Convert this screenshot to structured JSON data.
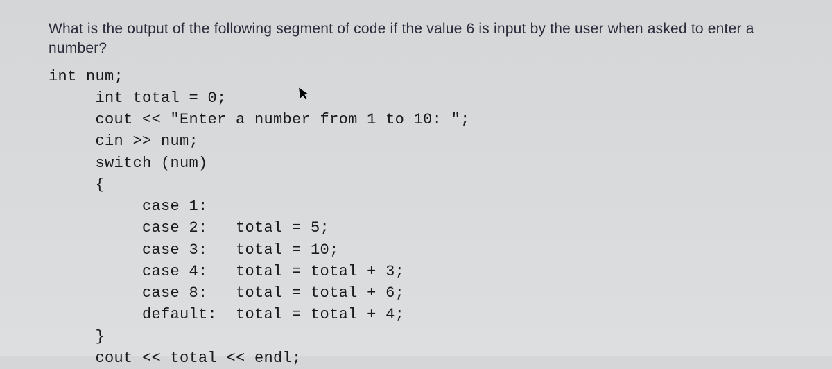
{
  "question": {
    "text": "What is the output of the following segment of code if the value 6 is input by the user when asked to enter a number?"
  },
  "code": {
    "line1": "int num;",
    "line2": "     int total = 0;",
    "line3": "     cout << \"Enter a number from 1 to 10: \";",
    "line4": "     cin >> num;",
    "line5": "     switch (num)",
    "line6": "     {",
    "line7": "          case 1:",
    "line8": "          case 2:   total = 5;",
    "line9": "          case 3:   total = 10;",
    "line10": "          case 4:   total = total + 3;",
    "line11": "          case 8:   total = total + 6;",
    "line12": "          default:  total = total + 4;",
    "line13": "     }",
    "line14": "     cout << total << endl;"
  }
}
